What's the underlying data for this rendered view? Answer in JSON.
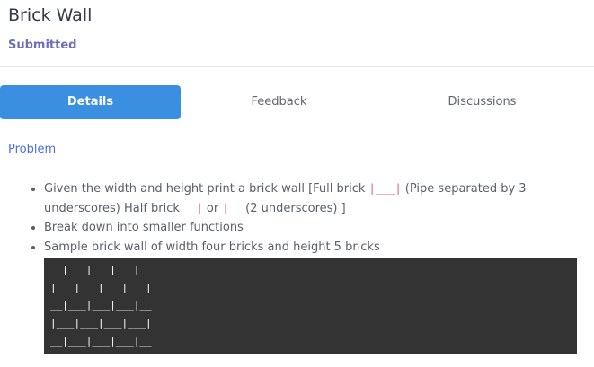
{
  "header": {
    "title": "Brick Wall",
    "status": "Submitted"
  },
  "tabs": [
    {
      "label": "Details",
      "active": true
    },
    {
      "label": "Feedback",
      "active": false
    },
    {
      "label": "Discussions",
      "active": false
    }
  ],
  "problem": {
    "label": "Problem",
    "bullet1": {
      "pre": "Given the width and height print a brick wall [Full brick ",
      "full_brick": "|___|",
      "mid": " (Pipe separated by 3 underscores) Half brick ",
      "half_brick_1": "__|",
      "or": " or ",
      "half_brick_2": "|__",
      "post": " (2 underscores) ]"
    },
    "bullet2": "Break down into smaller functions",
    "bullet3": "Sample brick wall of width four bricks and height 5 bricks",
    "code": "__|___|___|___|__\n|___|___|___|___|\n__|___|___|___|__\n|___|___|___|___|\n__|___|___|___|__"
  },
  "colors": {
    "accent": "#3b8fe0",
    "status": "#6d6fb5",
    "link": "#4b6edc",
    "inline_code": "#e0558a",
    "code_bg": "#333333"
  }
}
